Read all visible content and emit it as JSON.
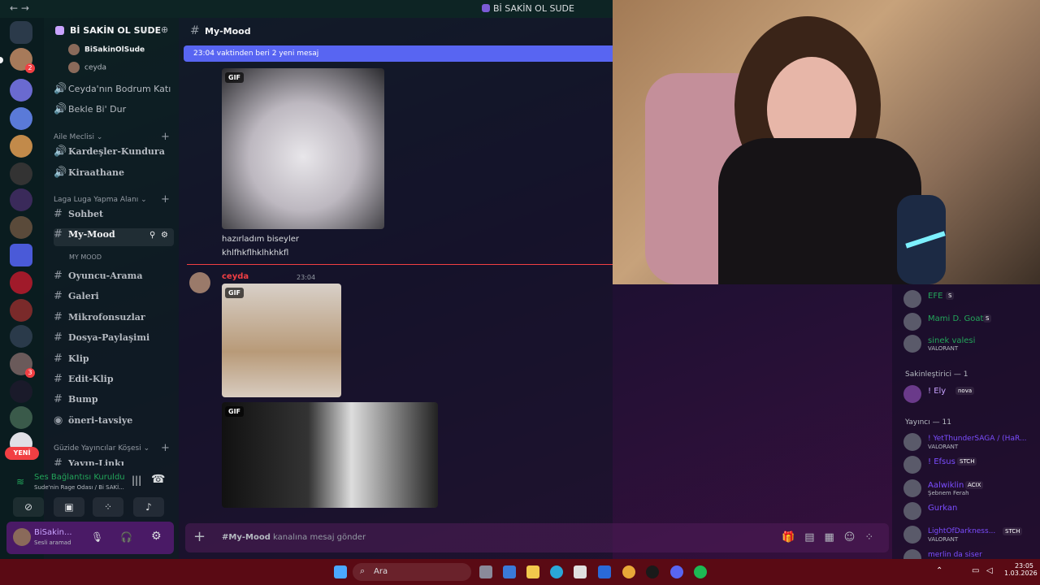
{
  "window": {
    "title": "Bİ SAKİN OL SUDE"
  },
  "colors": {
    "accent": "#5865f2",
    "online": "#23a55a",
    "alert": "#f23f43"
  },
  "server": {
    "name": "Bİ SAKİN OL SUDE"
  },
  "voice_members": [
    {
      "name": "BiSakinOlSude"
    },
    {
      "name": "ceyda"
    }
  ],
  "channels_top": [
    {
      "label": "Ceyda'nın Bodrum Katı",
      "icon": "speaker-icon"
    },
    {
      "label": "Bekle Bi' Dur",
      "icon": "speaker-icon"
    }
  ],
  "cat_aile": {
    "label": "Aile Meclisi",
    "channels": [
      "Kardeşler-Kundura",
      "Kiraathane"
    ]
  },
  "cat_laga": {
    "label": "Laga Luga Yapma Alanı",
    "channels": [
      "Sohbet",
      "My-Mood",
      "Oyuncu-Arama",
      "Galeri",
      "Mikrofonsuzlar",
      "Dosya-Paylaşimi",
      "Klip",
      "Edit-Klip",
      "Bump",
      "öneri-tavsiye"
    ],
    "thread": "MY MOOD"
  },
  "cat_guzide": {
    "label": "Güzide Yayıncılar Köşesi",
    "partial": "Yayın-Linkı"
  },
  "new_badge": "YENİ",
  "voice_panel": {
    "status": "Ses Bağlantısı Kuruldu",
    "sub": "Sude'nin Rage Odası / Bi SAKİ..."
  },
  "user_panel": {
    "name": "BiSakin...",
    "status": "Sesli aramad"
  },
  "chat": {
    "channel": "My-Mood",
    "new_messages": "23:04 vaktinden beri 2 yeni mesaj",
    "gif_tag": "GIF",
    "lines": [
      "hazırladım biseyler",
      "khlfhkflhklhkhkfl"
    ],
    "author": "ceyda",
    "time": "23:04",
    "input_channel": "#My-Mood",
    "input_placeholder": "kanalına mesaj gönder"
  },
  "members": [
    {
      "name": "EFE",
      "game": ""
    },
    {
      "name": "Mami D. Goat",
      "game": ""
    },
    {
      "name": "sinek valesi",
      "game": "VALORANT"
    }
  ],
  "role_sakin": "Sakinleştirici — 1",
  "member_ely": {
    "name": "! Ely",
    "tag": "nova"
  },
  "role_yayinci": "Yayıncı — 11",
  "streamers": [
    {
      "name": "! YetThunderSAGA / (HaR...",
      "game": "VALORANT",
      "tag": ""
    },
    {
      "name": "! Efsus",
      "game": "",
      "tag": "STCH"
    },
    {
      "name": "Aalwiklin",
      "game": "Şebnem Ferah",
      "tag": "ACIX"
    },
    {
      "name": "Gurkan",
      "game": "",
      "tag": ""
    },
    {
      "name": "LightOfDarkness...",
      "game": "VALORANT",
      "tag": "STCH"
    },
    {
      "name": "merlin da siser",
      "game": "",
      "tag": ""
    }
  ],
  "taskbar": {
    "search": "Ara",
    "time": "23:05",
    "date": "1.03.2026"
  }
}
